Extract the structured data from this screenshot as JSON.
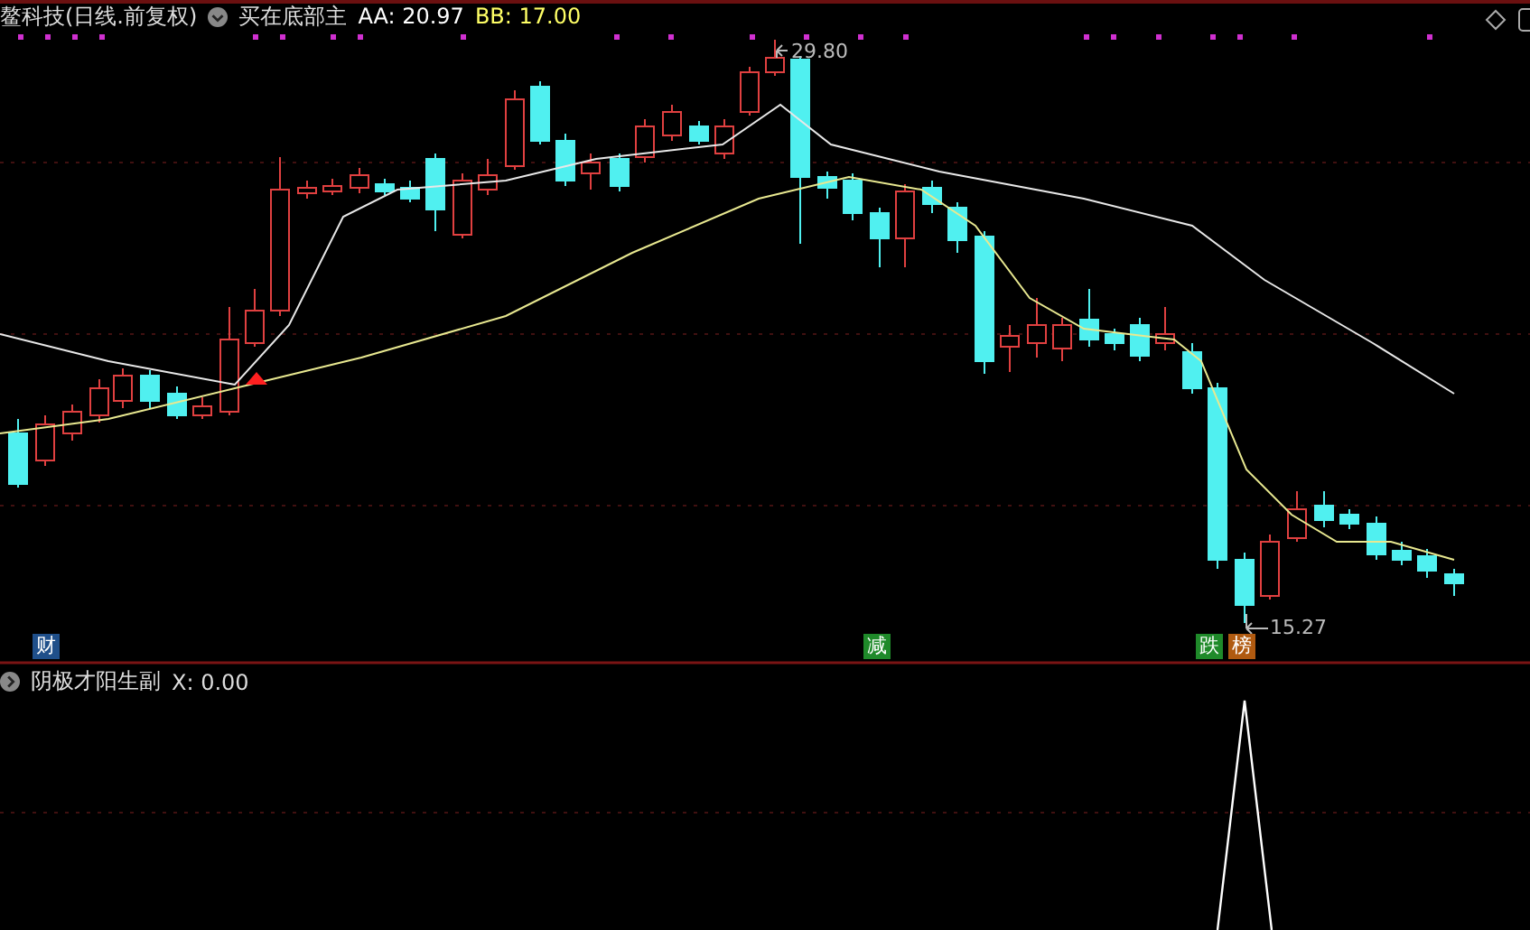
{
  "main_panel": {
    "title": "鳌科技(日线.前复权)",
    "indicator_name": "买在底部主",
    "readings": [
      {
        "label": "AA: 20.97",
        "color": "#ffffff"
      },
      {
        "label": "BB: 17.00",
        "color": "#ffff66"
      }
    ],
    "max_label": "29.80",
    "min_label": "15.27",
    "event_tags": [
      {
        "text": "财",
        "color": "#1f4f8a"
      },
      {
        "text": "减",
        "color": "#1f8a2a"
      },
      {
        "text": "跌",
        "color": "#1f8a2a"
      },
      {
        "text": "榜",
        "color": "#b05a10"
      }
    ]
  },
  "sub_panel": {
    "indicator_name": "阴极才阳生副",
    "readings": [
      {
        "label": "X: 0.00",
        "color": "#dddddd"
      }
    ]
  }
}
